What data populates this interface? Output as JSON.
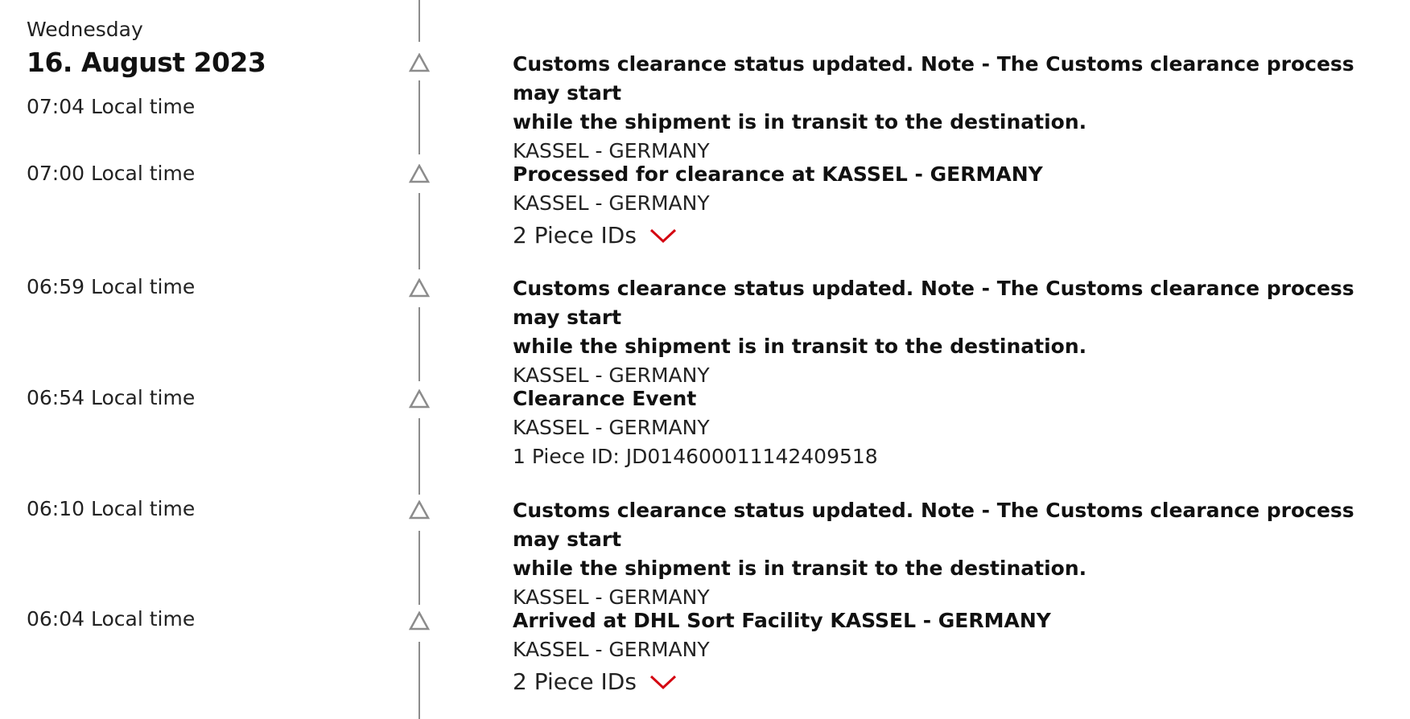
{
  "header": {
    "weekday": "Wednesday",
    "date": "16. August 2023"
  },
  "events": [
    {
      "time": "07:04 Local time",
      "title_line1": "Customs clearance status updated. Note - The Customs clearance process may start",
      "title_line2": "while the shipment is in transit to the destination.",
      "location": "KASSEL - GERMANY"
    },
    {
      "time": "07:00 Local time",
      "title_line1": "Processed for clearance at KASSEL - GERMANY",
      "location": "KASSEL - GERMANY",
      "pieces_toggle": "2 Piece IDs"
    },
    {
      "time": "06:59 Local time",
      "title_line1": "Customs clearance status updated. Note - The Customs clearance process may start",
      "title_line2": "while the shipment is in transit to the destination.",
      "location": "KASSEL - GERMANY"
    },
    {
      "time": "06:54 Local time",
      "title_line1": "Clearance Event",
      "location": "KASSEL - GERMANY",
      "piece_id": "1 Piece ID: JD014600011142409518"
    },
    {
      "time": "06:10 Local time",
      "title_line1": "Customs clearance status updated. Note - The Customs clearance process may start",
      "title_line2": "while the shipment is in transit to the destination.",
      "location": "KASSEL - GERMANY"
    },
    {
      "time": "06:04 Local time",
      "title_line1": "Arrived at DHL Sort Facility KASSEL - GERMANY",
      "location": "KASSEL - GERMANY",
      "pieces_toggle": "2 Piece IDs"
    }
  ],
  "colors": {
    "timeline": "#8c8c8c",
    "chevron_accent": "#d40511"
  },
  "icons": {
    "marker": "triangle-outline-icon",
    "expand": "chevron-down-icon"
  }
}
